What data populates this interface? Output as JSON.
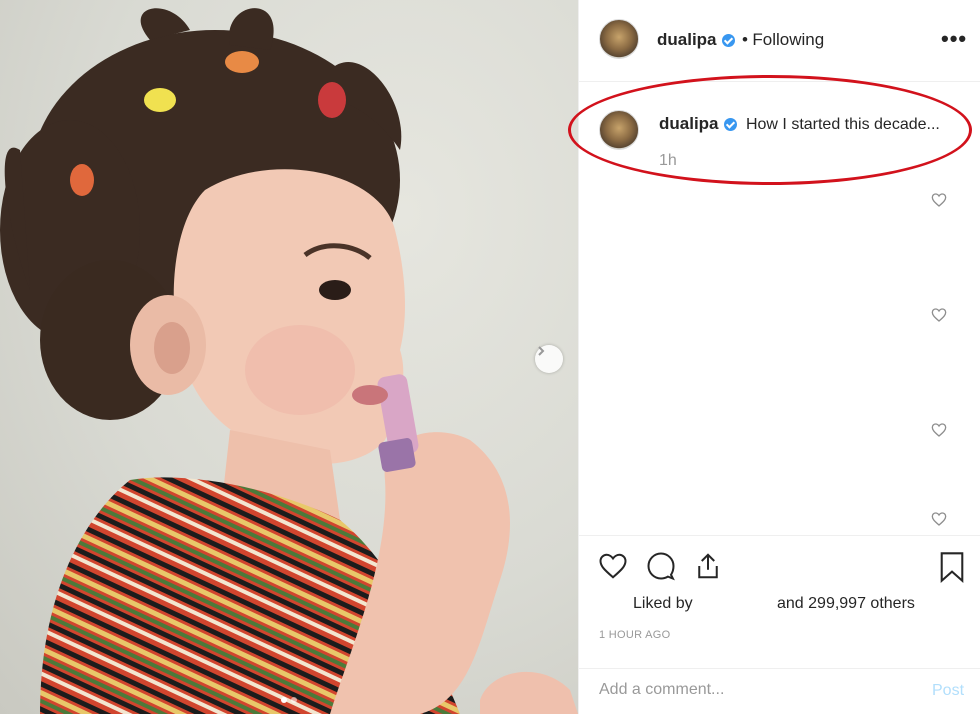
{
  "photo": {
    "next_icon": "chevron-right-icon",
    "carousel_count": 2,
    "carousel_active": 1
  },
  "post": {
    "username": "dualipa",
    "separator": "•",
    "follow_state": "Following",
    "more_icon": "ellipsis-icon",
    "more_label": "•••"
  },
  "caption": {
    "username": "dualipa",
    "text": "How I started this decade...",
    "time": "1h"
  },
  "comment_like_icons": [
    "heart-outline-icon",
    "heart-outline-icon",
    "heart-outline-icon",
    "heart-outline-icon"
  ],
  "actions": {
    "like_icon": "heart-icon",
    "comment_icon": "comment-icon",
    "share_icon": "share-icon",
    "save_icon": "bookmark-icon",
    "liked_by": "Liked by",
    "others": "and 299,997 others",
    "time_ago": "1 HOUR AGO"
  },
  "comment_form": {
    "placeholder": "Add a comment...",
    "post_label": "Post"
  },
  "colors": {
    "verified": "#3897f0",
    "highlight_ring": "#d2121c",
    "post_disabled": "#b2dffc"
  }
}
